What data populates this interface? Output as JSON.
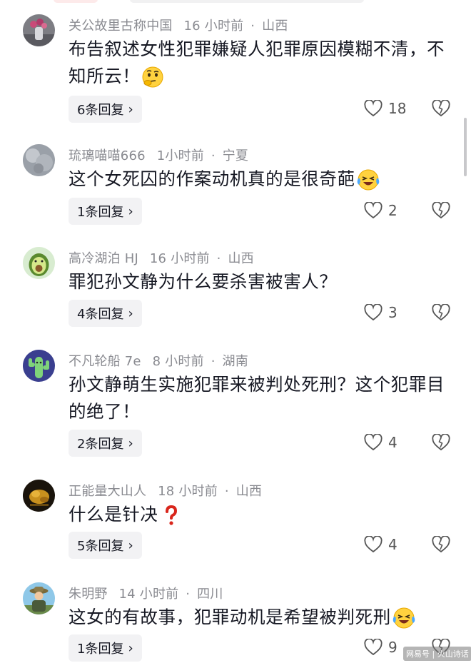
{
  "comments": [
    {
      "user": "关公故里古称中国",
      "time": "16 小时前",
      "location": "山西",
      "text": "布告叙述女性犯罪嫌疑人犯罪原因模糊不清，不知所云！",
      "emoji": "thinking-face-icon",
      "replies": "6条回复",
      "likes": "18"
    },
    {
      "user": "琉璃喵喵666",
      "time": "1小时前",
      "location": "宁夏",
      "text": "这个女死囚的作案动机真的是很奇葩",
      "emoji": "laughing-crying-face-icon",
      "replies": "1条回复",
      "likes": "2"
    },
    {
      "user": "高冷湖泊 HJ",
      "time": "16 小时前",
      "location": "山西",
      "text": "罪犯孙文静为什么要杀害被害人？",
      "emoji": "",
      "replies": "4条回复",
      "likes": "3"
    },
    {
      "user": "不凡轮船 7e",
      "time": "8 小时前",
      "location": "湖南",
      "text": "孙文静萌生实施犯罪来被判处死刑？这个犯罪目的绝了！",
      "emoji": "",
      "replies": "2条回复",
      "likes": "4"
    },
    {
      "user": "正能量大山人",
      "time": "18 小时前",
      "location": "山西",
      "text": "什么是针决",
      "emoji": "red-question-mark-icon",
      "replies": "5条回复",
      "likes": "4"
    },
    {
      "user": "朱明野",
      "time": "14 小时前",
      "location": "四川",
      "text": "这女的有故事，犯罪动机是希望被判死刑",
      "emoji": "laughing-crying-face-icon",
      "replies": "1条回复",
      "likes": "9"
    }
  ],
  "icons": {
    "like": "heart-outline-icon",
    "dislike": "broken-heart-icon",
    "chevron": "chevron-right-icon"
  },
  "meta_separator": "·",
  "chevron_glyph": "›",
  "watermark": "网易号 | 火山诗话",
  "colors": {
    "meta": "#8a8b91",
    "text": "#161823",
    "reply_bg": "#f2f2f4"
  }
}
